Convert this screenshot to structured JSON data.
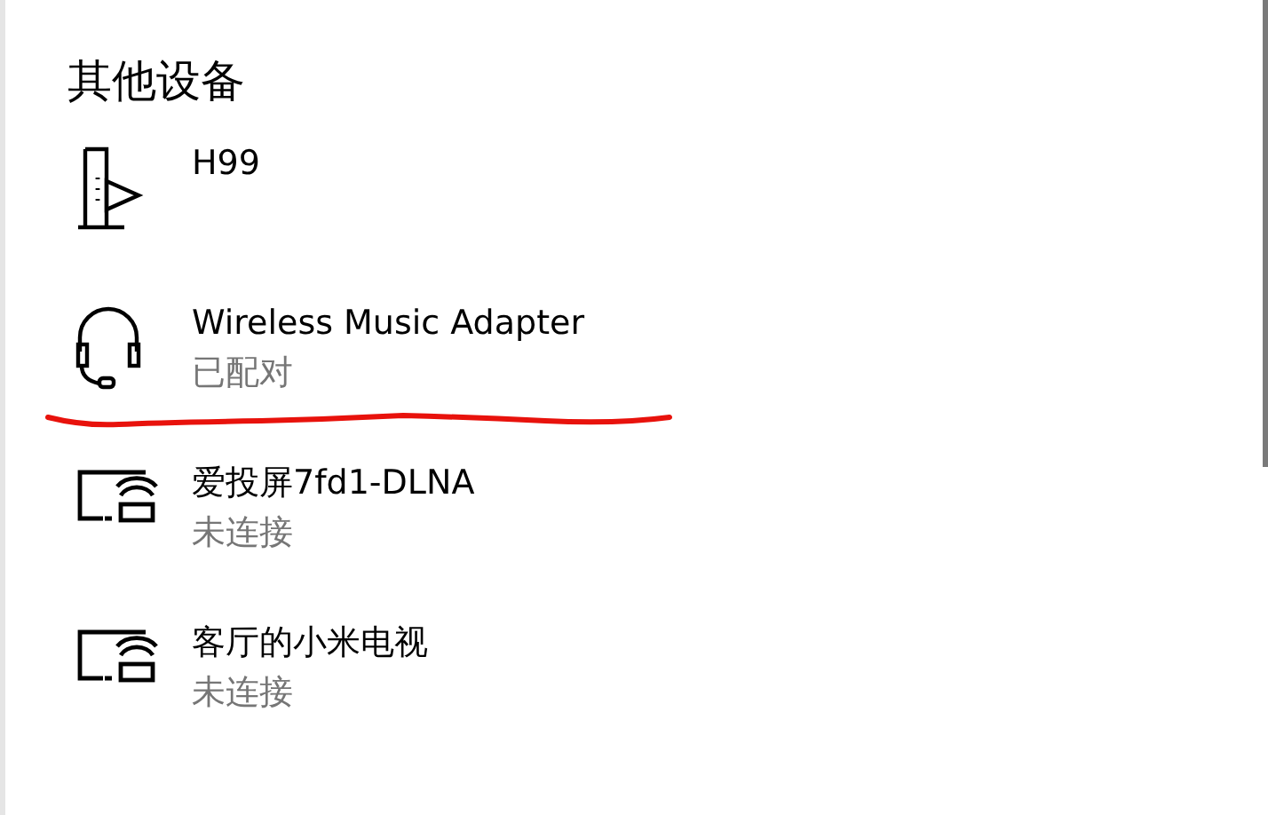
{
  "section_title": "其他设备",
  "devices": [
    {
      "kind": "media",
      "name": "H99"
    },
    {
      "kind": "headset",
      "name": "Wireless Music Adapter",
      "status": "已配对"
    },
    {
      "kind": "wireless-display",
      "name": "爱投屏7fd1-DLNA",
      "status": "未连接"
    },
    {
      "kind": "wireless-display",
      "name": "客厅的小米电视",
      "status": "未连接"
    }
  ]
}
